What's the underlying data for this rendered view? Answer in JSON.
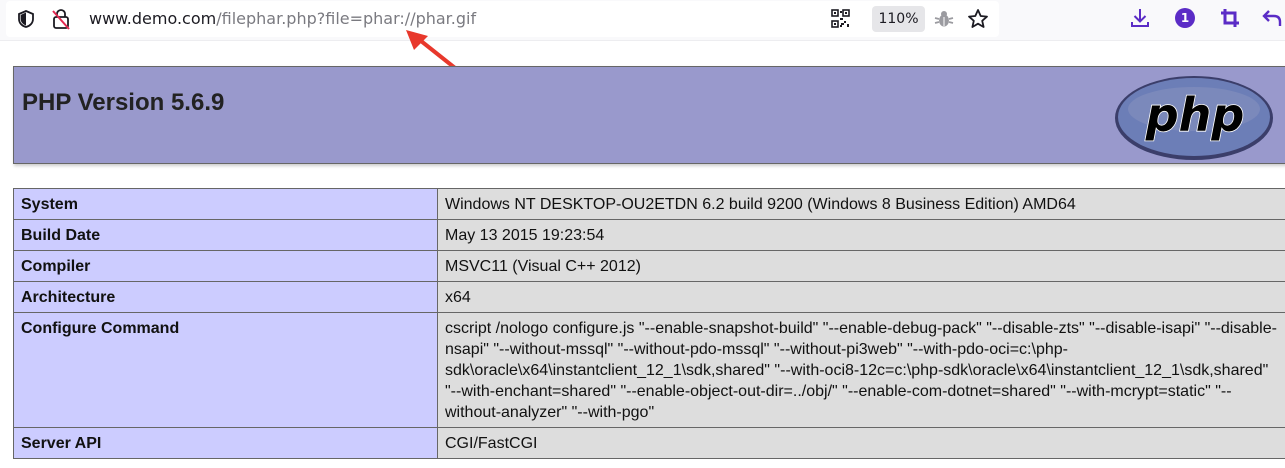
{
  "browser": {
    "url_host": "www.demo.com",
    "url_path": "/filephar.php?file=phar://phar.gif",
    "zoom_label": "110%",
    "notification_count": "1",
    "icons": [
      "shield-icon",
      "broken-lock-icon",
      "qr-code-icon",
      "bug-icon",
      "star-icon",
      "download-icon",
      "crop-icon",
      "undo-icon"
    ]
  },
  "annotation": {
    "arrow_color": "#e8382c"
  },
  "phpinfo": {
    "version_title": "PHP Version 5.6.9",
    "logo_text": "php",
    "rows": [
      {
        "key": "System",
        "value": "Windows NT DESKTOP-OU2ETDN 6.2 build 9200 (Windows 8 Business Edition) AMD64"
      },
      {
        "key": "Build Date",
        "value": "May 13 2015 19:23:54"
      },
      {
        "key": "Compiler",
        "value": "MSVC11 (Visual C++ 2012)"
      },
      {
        "key": "Architecture",
        "value": "x64"
      },
      {
        "key": "Configure Command",
        "value": "cscript /nologo configure.js \"--enable-snapshot-build\" \"--enable-debug-pack\" \"--disable-zts\" \"--disable-isapi\" \"--disable-nsapi\" \"--without-mssql\" \"--without-pdo-mssql\" \"--without-pi3web\" \"--with-pdo-oci=c:\\php-sdk\\oracle\\x64\\instantclient_12_1\\sdk,shared\" \"--with-oci8-12c=c:\\php-sdk\\oracle\\x64\\instantclient_12_1\\sdk,shared\" \"--with-enchant=shared\" \"--enable-object-out-dir=../obj/\" \"--enable-com-dotnet=shared\" \"--with-mcrypt=static\" \"--without-analyzer\" \"--with-pgo\""
      },
      {
        "key": "Server API",
        "value": "CGI/FastCGI"
      }
    ]
  },
  "colors": {
    "header_bg": "#9999cc",
    "key_bg": "#ccccff",
    "value_bg": "#dddddd",
    "logo_bg": "#6c7eb7"
  }
}
